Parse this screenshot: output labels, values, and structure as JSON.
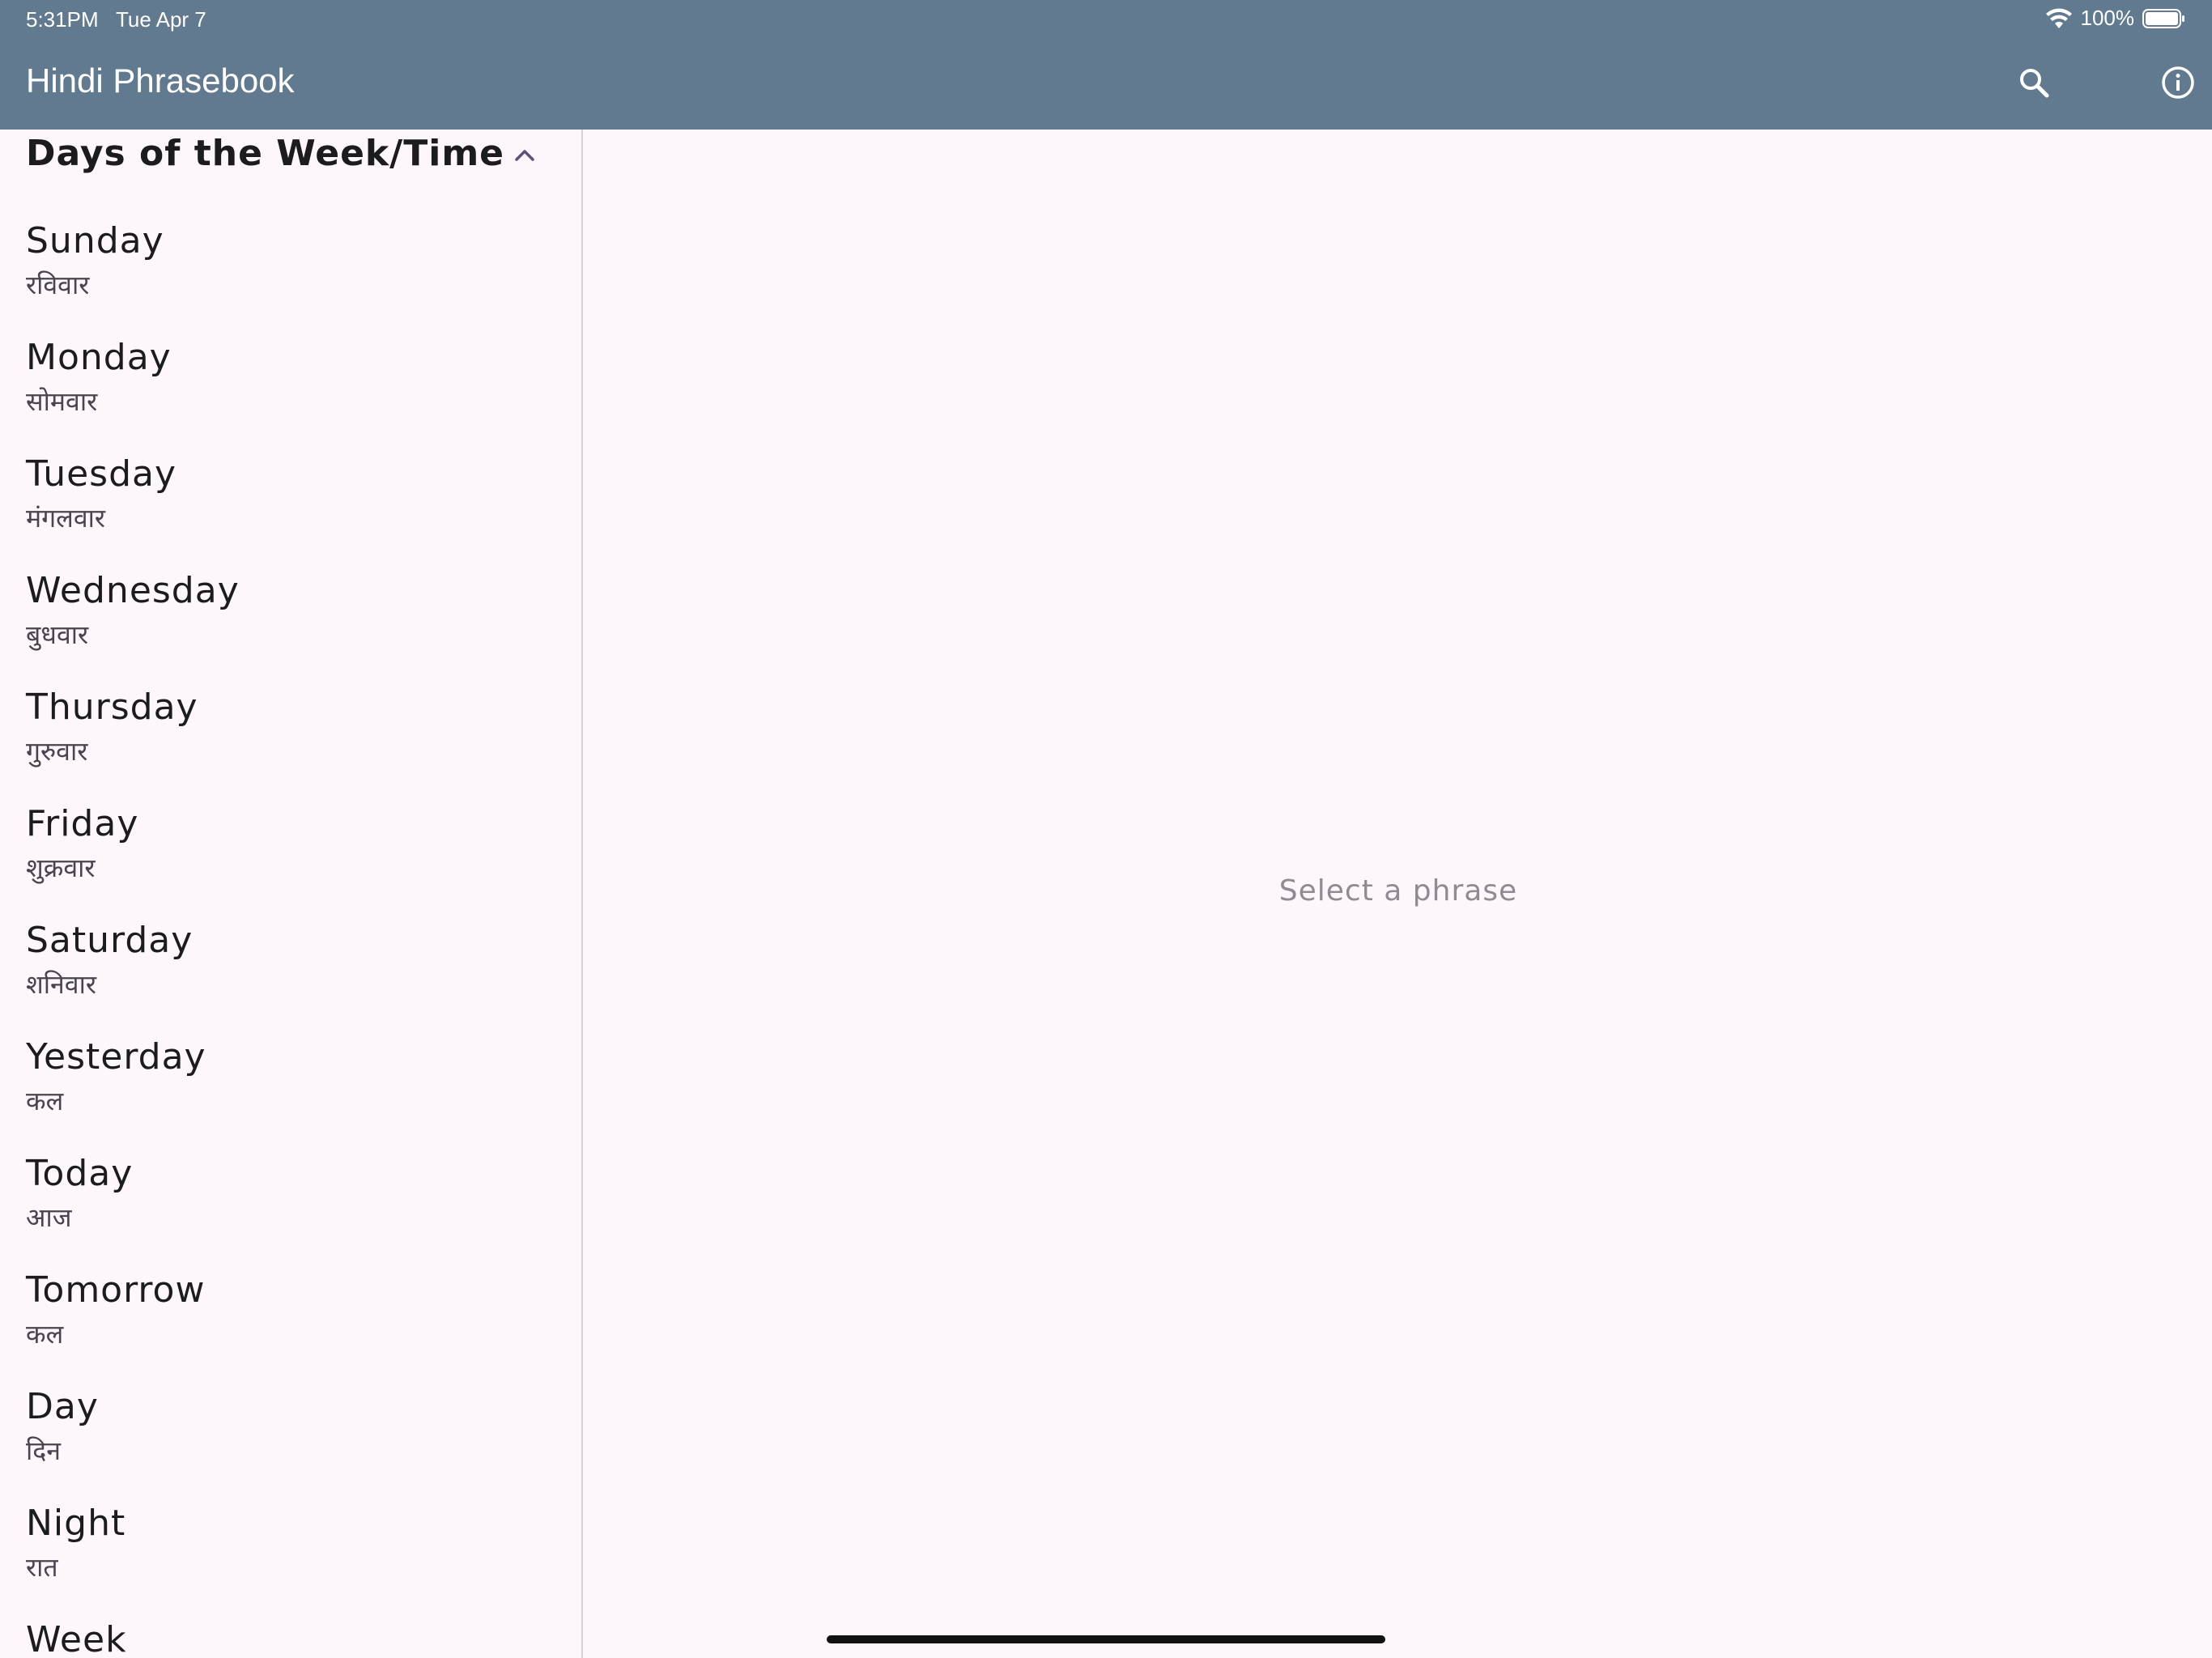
{
  "status_bar": {
    "time": "5:31PM",
    "date": "Tue Apr 7",
    "battery_percent": "100%",
    "wifi_icon": "wifi-icon",
    "battery_icon": "battery-icon"
  },
  "app_bar": {
    "title": "Hindi Phrasebook",
    "search_icon": "search-icon",
    "info_icon": "info-icon",
    "background_color": "#617a8f"
  },
  "sidebar": {
    "section_title": "Days of the Week/Time",
    "collapse_icon": "chevron-up-icon",
    "items": [
      {
        "en": "Sunday",
        "hi": "रविवार"
      },
      {
        "en": "Monday",
        "hi": "सोमवार"
      },
      {
        "en": "Tuesday",
        "hi": "मंगलवार"
      },
      {
        "en": "Wednesday",
        "hi": "बुधवार"
      },
      {
        "en": "Thursday",
        "hi": "गुरुवार"
      },
      {
        "en": "Friday",
        "hi": "शुक्रवार"
      },
      {
        "en": "Saturday",
        "hi": "शनिवार"
      },
      {
        "en": "Yesterday",
        "hi": "कल"
      },
      {
        "en": "Today",
        "hi": "आज"
      },
      {
        "en": "Tomorrow",
        "hi": "कल"
      },
      {
        "en": "Day",
        "hi": "दिन"
      },
      {
        "en": "Night",
        "hi": "रात"
      },
      {
        "en": "Week",
        "hi": ""
      }
    ]
  },
  "detail": {
    "placeholder": "Select a phrase"
  }
}
